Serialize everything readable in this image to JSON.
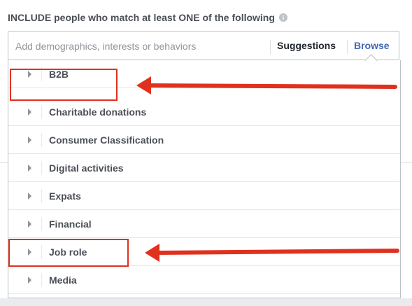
{
  "header": {
    "title": "INCLUDE people who match at least ONE of the following",
    "info_icon": "info-icon"
  },
  "search": {
    "placeholder": "Add demographics, interests or behaviors",
    "value": "",
    "suggestions_label": "Suggestions",
    "browse_label": "Browse"
  },
  "dropdown": {
    "items": [
      {
        "label": "B2B"
      },
      {
        "label": "Charitable donations"
      },
      {
        "label": "Consumer Classification"
      },
      {
        "label": "Digital activities"
      },
      {
        "label": "Expats"
      },
      {
        "label": "Financial"
      },
      {
        "label": "Job role"
      },
      {
        "label": "Media"
      }
    ]
  },
  "colors": {
    "accent": "#4267b2",
    "annotation": "#e0311f",
    "text": "#4b4f56"
  }
}
